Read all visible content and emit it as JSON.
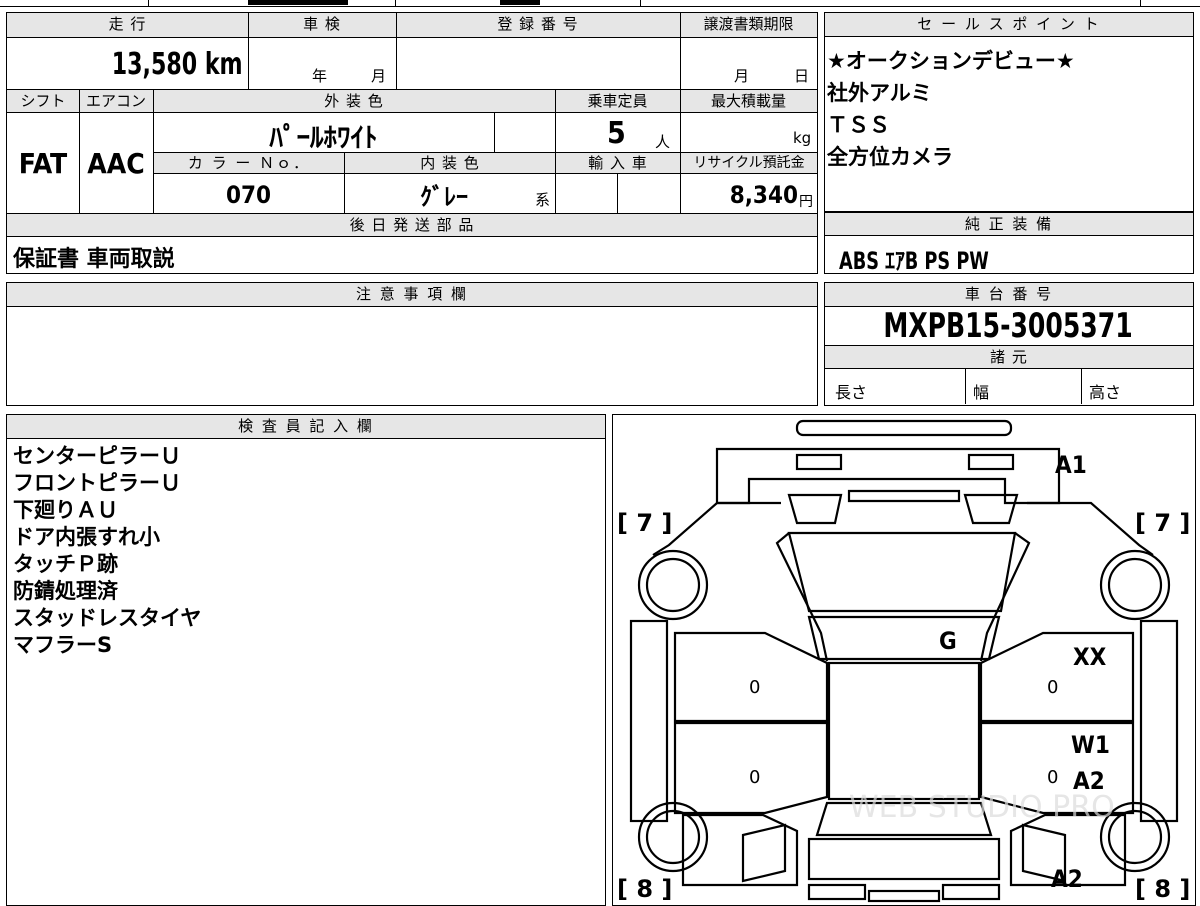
{
  "vehicle": {
    "mileage_label": "走 行",
    "mileage": "13,580",
    "mileage_unit": "km",
    "inspection_label": "車 検",
    "inspection_year_unit": "年",
    "inspection_month_unit": "月",
    "registration_label": "登 録 番 号",
    "transfer_label": "譲渡書類期限",
    "transfer_month_unit": "月",
    "transfer_day_unit": "日",
    "shift_label": "シフト",
    "shift": "FAT",
    "aircon_label": "エアコン",
    "aircon": "AAC",
    "exterior_color_label": "外 装 色",
    "exterior_color": "ﾊﾟｰﾙﾎﾜｲﾄ",
    "capacity_label": "乗車定員",
    "capacity": "5",
    "capacity_unit": "人",
    "max_load_label": "最大積載量",
    "max_load_unit": "kg",
    "color_no_label": "カ ラ ー Ｎｏ．",
    "color_no": "070",
    "interior_color_label": "内 装 色",
    "interior_color": "ｸﾞﾚｰ",
    "interior_color_suffix": "系",
    "import_label": "輸 入 車",
    "recycle_label": "リサイクル預託金",
    "recycle_fee": "8,340",
    "recycle_unit": "円"
  },
  "later_parts": {
    "label": "後 日 発 送 部 品",
    "value": "保証書 車両取説"
  },
  "notes": {
    "label": "注 意 事 項 欄"
  },
  "sales_points": {
    "label": "セ ー ル ス ポ イ ン ト",
    "items": [
      "★オークションデビュー★",
      "社外アルミ",
      "ＴＳＳ",
      "全方位カメラ"
    ]
  },
  "equipment": {
    "label": "純 正 装 備",
    "value": "ABS ｴｱB PS PW"
  },
  "chassis": {
    "label": "車 台 番 号",
    "value": "MXPB15-3005371"
  },
  "specs": {
    "label": "諸 元",
    "length_label": "長さ",
    "width_label": "幅",
    "height_label": "高さ"
  },
  "inspector": {
    "label": "検 査 員 記 入 欄",
    "lines": [
      "センターピラーＵ",
      "フロントピラーＵ",
      "下廻りＡＵ",
      "ドア内張すれ小",
      "タッチＰ跡",
      "防錆処理済",
      "スタッドレスタイヤ",
      "マフラーS"
    ]
  },
  "diagram": {
    "marks": {
      "a1": "A1",
      "g": "G",
      "xx": "XX",
      "w1": "W1",
      "a2_side": "A2",
      "a2_rear": "A2"
    },
    "tire_top_left": "[ 7 ]",
    "tire_top_right": "[ 7 ]",
    "tire_bottom_left": "[ 8 ]",
    "tire_bottom_right": "[ 8 ]",
    "zero_marks": [
      "0",
      "0",
      "0",
      "0"
    ],
    "watermark": "WEB STUDIO PRO"
  }
}
